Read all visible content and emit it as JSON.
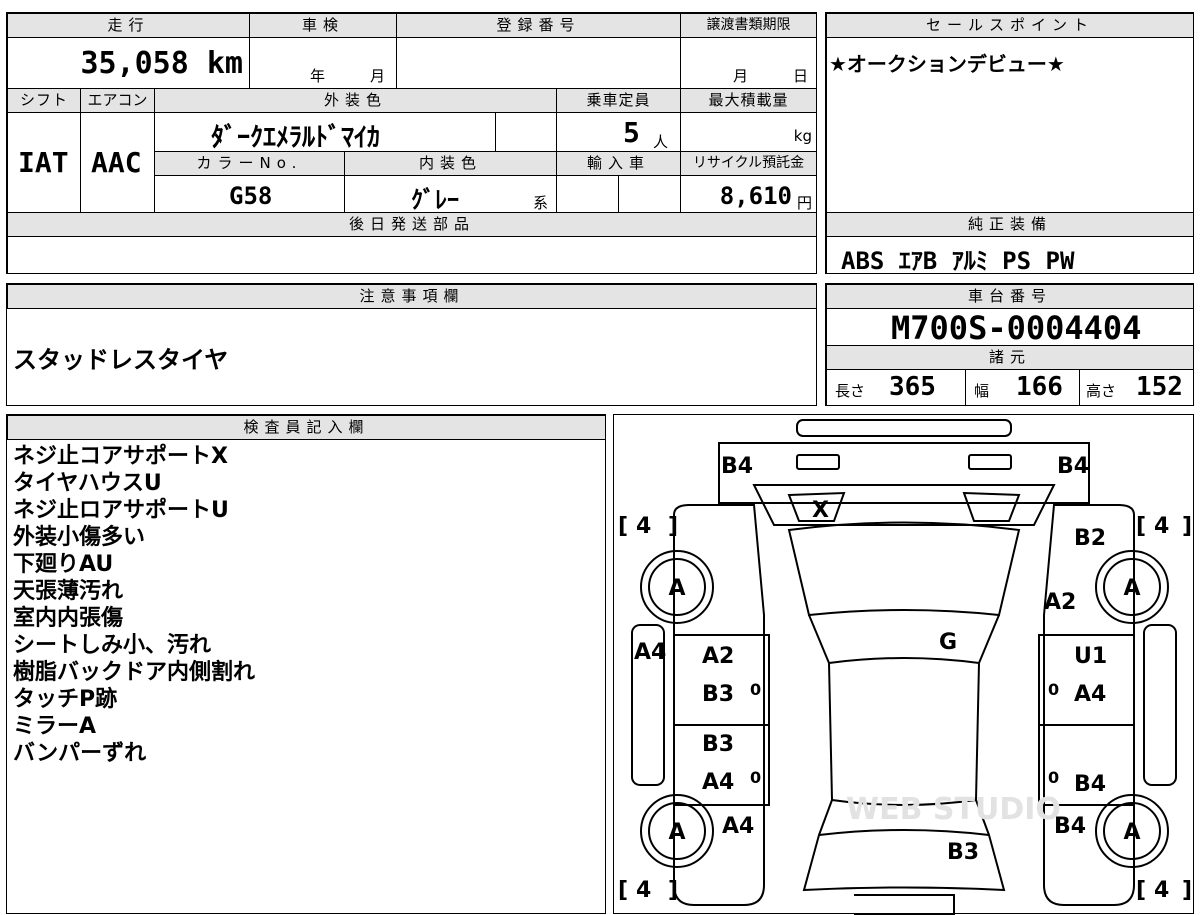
{
  "top": {
    "mileage_label": "走行",
    "mileage_value": "35,058 km",
    "inspection_label": "車検",
    "inspection_year": "年",
    "inspection_month": "月",
    "registration_label": "登録番号",
    "transfer_deadline_label": "譲渡書類期限",
    "transfer_month": "月",
    "transfer_day": "日",
    "shift_label": "シフト",
    "shift_value": "IAT",
    "aircon_label": "エアコン",
    "aircon_value": "AAC",
    "exterior_color_label": "外装色",
    "exterior_color_value": "ﾀﾞｰｸｴﾒﾗﾙﾄﾞﾏｲｶ",
    "capacity_label": "乗車定員",
    "capacity_value": "5",
    "capacity_unit": "人",
    "max_load_label": "最大積載量",
    "max_load_unit": "kg",
    "color_no_label": "カラーNo.",
    "color_no_value": "G58",
    "interior_color_label": "内装色",
    "interior_color_value": "ｸﾞﾚｰ",
    "interior_color_suffix": "系",
    "import_label": "輸入車",
    "recycle_label": "リサイクル預託金",
    "recycle_value": "8,610",
    "recycle_unit": "円",
    "later_parts_label": "後日発送部品"
  },
  "sales": {
    "label": "セールスポイント",
    "value": "★オークションデビュー★"
  },
  "equipment": {
    "label": "純正装備",
    "value": "ABS ｴｱB ｱﾙﾐ PS PW"
  },
  "notes": {
    "label": "注意事項欄",
    "value": "スタッドレスタイヤ"
  },
  "chassis": {
    "label": "車台番号",
    "value": "M700S-0004404",
    "specs_label": "諸元",
    "length_label": "長さ",
    "length_value": "365",
    "width_label": "幅",
    "width_value": "166",
    "height_label": "高さ",
    "height_value": "152"
  },
  "inspector": {
    "label": "検査員記入欄",
    "lines": [
      "ネジ止コアサポートX",
      "タイヤハウスU",
      "ネジ止ロアサポートU",
      "外装小傷多い",
      "下廻りAU",
      "天張薄汚れ",
      "室内内張傷",
      "シートしみ小、汚れ",
      "樹脂バックドア内側割れ",
      "タッチP跡",
      "ミラーA",
      "バンパーずれ"
    ]
  },
  "diagram": {
    "tire_depth": "4",
    "wheel_grade": "A",
    "marks": {
      "front_left_corner": "B4",
      "front_right_corner": "B4",
      "hood_center": "X",
      "right_front_fender_upper": "B2",
      "right_front_fender_lower": "A2",
      "windshield": "G",
      "left_side_panel": "A4",
      "left_front_door_1": "A2",
      "left_front_door_2": "B3",
      "left_rear_door_1": "B3",
      "left_rear_door_2": "A4",
      "left_rear_fender": "A4",
      "right_front_door_1": "U1",
      "right_front_door_2": "A4",
      "right_rear_door": "B4",
      "right_rear_fender": "B4",
      "rear_center": "B3",
      "handle": "0",
      "watermark": "WEB STUDIO"
    }
  }
}
